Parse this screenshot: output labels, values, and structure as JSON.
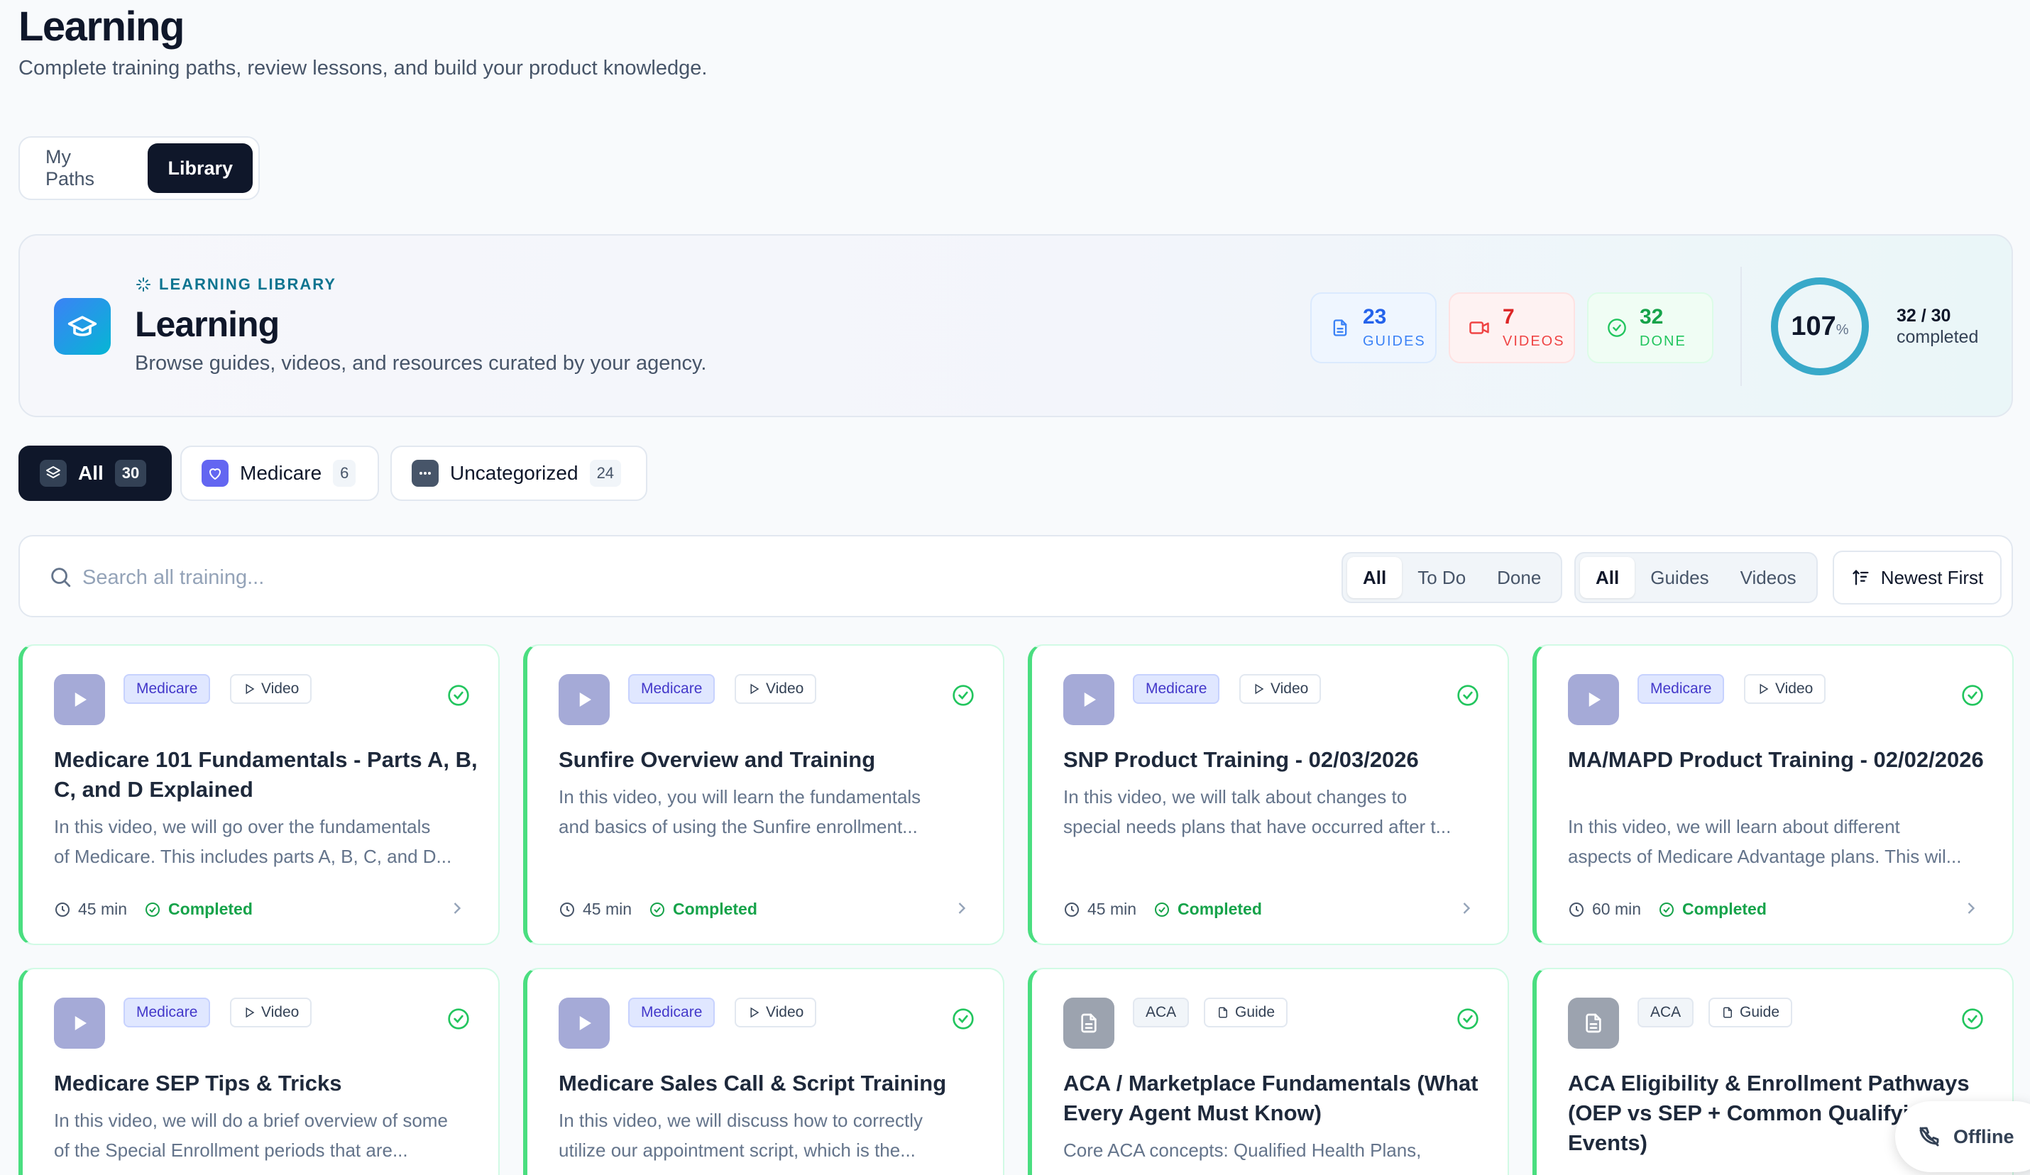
{
  "header": {
    "title": "Learning",
    "subtitle": "Complete training paths, review lessons, and build your product knowledge."
  },
  "top_tabs": [
    {
      "label": "My Paths",
      "active": false
    },
    {
      "label": "Library",
      "active": true
    }
  ],
  "hero": {
    "eyebrow": "LEARNING LIBRARY",
    "title": "Learning",
    "description": "Browse guides, videos, and resources curated by your agency.",
    "stats": {
      "guides": {
        "value": "23",
        "label": "GUIDES"
      },
      "videos": {
        "value": "7",
        "label": "VIDEOS"
      },
      "done": {
        "value": "32",
        "label": "DONE"
      }
    },
    "progress": {
      "percent_value": "107",
      "percent_sign": "%",
      "fraction": "32 / 30",
      "caption": "completed",
      "ring_fill": 1.0
    }
  },
  "categories": [
    {
      "label": "All",
      "count": "30",
      "active": true,
      "icon": "layers-icon"
    },
    {
      "label": "Medicare",
      "count": "6",
      "active": false,
      "icon": "heart-icon"
    },
    {
      "label": "Uncategorized",
      "count": "24",
      "active": false,
      "icon": "more-icon"
    }
  ],
  "search": {
    "placeholder": "Search all training..."
  },
  "status_filters": [
    "All",
    "To Do",
    "Done"
  ],
  "type_filters": [
    "All",
    "Guides",
    "Videos"
  ],
  "sort": {
    "label": "Newest First"
  },
  "courses": [
    {
      "category": "Medicare",
      "type": "Video",
      "title": "Medicare 101 Fundamentals - Parts A, B, C, and D Explained",
      "desc1": "In this video, we will go over the fundamentals",
      "desc2": "of Medicare. This includes parts A, B, C, and D...",
      "duration": "45 min",
      "status": "Completed"
    },
    {
      "category": "Medicare",
      "type": "Video",
      "title": "Sunfire Overview and Training",
      "desc1": "In this video, you will learn the fundamentals",
      "desc2": "and basics of using the Sunfire enrollment...",
      "duration": "45 min",
      "status": "Completed"
    },
    {
      "category": "Medicare",
      "type": "Video",
      "title": "SNP Product Training - 02/03/2026",
      "desc1": "In this video, we will talk about changes to",
      "desc2": "special needs plans that have occurred after t...",
      "duration": "45 min",
      "status": "Completed"
    },
    {
      "category": "Medicare",
      "type": "Video",
      "title": "MA/MAPD Product Training - 02/02/2026",
      "desc1": "In this video, we will learn about different",
      "desc2": "aspects of Medicare Advantage plans. This wil...",
      "duration": "60 min",
      "status": "Completed"
    },
    {
      "category": "Medicare",
      "type": "Video",
      "title": "Medicare SEP Tips & Tricks",
      "desc1": "In this video, we will do a brief overview of some",
      "desc2": "of the Special Enrollment periods that are...",
      "duration": "",
      "status": ""
    },
    {
      "category": "Medicare",
      "type": "Video",
      "title": "Medicare Sales Call & Script Training",
      "desc1": "In this video, we will discuss how to correctly",
      "desc2": "utilize our appointment script, which is the...",
      "duration": "",
      "status": ""
    },
    {
      "category": "ACA",
      "type": "Guide",
      "title": "ACA / Marketplace Fundamentals (What Every Agent Must Know)",
      "desc1": "Core ACA concepts: Qualified Health Plans,",
      "desc2": "",
      "duration": "",
      "status": ""
    },
    {
      "category": "ACA",
      "type": "Guide",
      "title": "ACA Eligibility & Enrollment Pathways (OEP vs SEP + Common Qualifying Events)",
      "desc1": "",
      "desc2": "",
      "duration": "",
      "status": ""
    }
  ],
  "offline": {
    "label": "Offline"
  },
  "colors": {
    "accent_dark": "#0f172a",
    "completed_green": "#16a34a",
    "medicare_badge": "#4338ca",
    "ring": "#38a9c9"
  }
}
